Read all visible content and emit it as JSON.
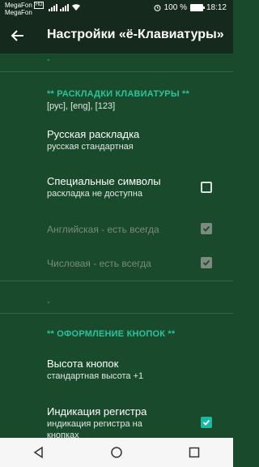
{
  "status_bar": {
    "carrier1": "MegaFon",
    "carrier1_badge": "HD",
    "carrier2": "MegaFon",
    "battery": "100 %",
    "time": "18:12"
  },
  "app_bar": {
    "title": "Настройки «ё-Клавиатуры»"
  },
  "dash_top": "-",
  "section_layouts": {
    "title": "**  РАСКЛАДКИ КЛАВИАТУРЫ  **",
    "subtitle": "[рус], [eng], [123]"
  },
  "items": [
    {
      "title": "Русская раскладка",
      "summary": "русская стандартная"
    },
    {
      "title": "Специальные символы",
      "summary": "раскладка не доступна",
      "checked": false
    },
    {
      "title": "Английская - есть всегда",
      "checked": true,
      "disabled": true
    },
    {
      "title": "Числовая - есть всегда",
      "checked": true,
      "disabled": true
    }
  ],
  "dash_mid": "-",
  "section_buttons": {
    "title": "**  ОФОРМЛЕНИЕ КНОПОК  **"
  },
  "items2": [
    {
      "title": "Высота кнопок",
      "summary": "стандартная высота +1"
    },
    {
      "title": "Индикация регистра",
      "summary": "индикация регистра на кнопках",
      "checked": true
    }
  ],
  "nav_icons": [
    "back-triangle",
    "home-circle",
    "recents-square"
  ],
  "colors": {
    "background": "#1a4a2c",
    "bar": "#152a1c",
    "accent": "#27c4a0",
    "checkbox_checked": "#19b9a2"
  }
}
